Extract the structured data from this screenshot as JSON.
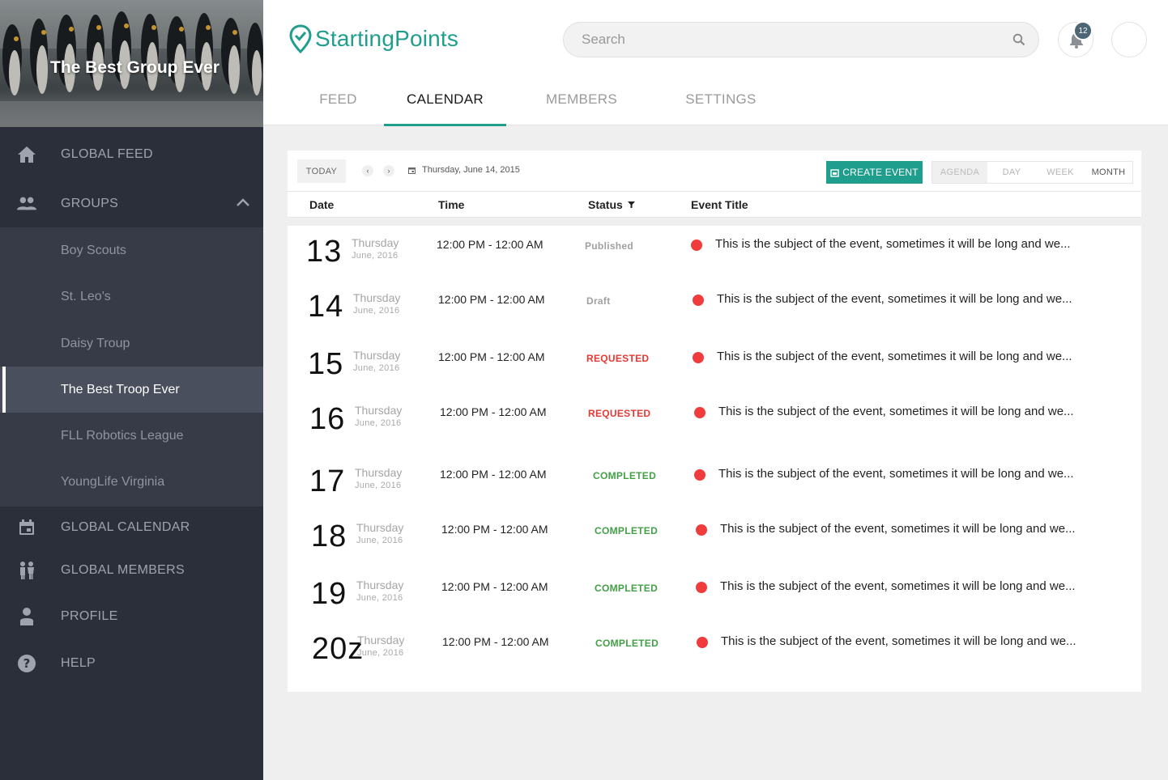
{
  "group": {
    "title": "The Best Group Ever"
  },
  "nav": {
    "global_feed": "GLOBAL FEED",
    "groups": "GROUPS",
    "global_calendar": "GLOBAL CALENDAR",
    "global_members": "GLOBAL MEMBERS",
    "profile": "PROFILE",
    "help": "HELP"
  },
  "groups": [
    {
      "label": "Boy Scouts"
    },
    {
      "label": "St. Leo's"
    },
    {
      "label": "Daisy Troup"
    },
    {
      "label": "The Best Troop Ever",
      "active": true
    },
    {
      "label": "FLL Robotics League"
    },
    {
      "label": "YoungLife Virginia"
    }
  ],
  "header": {
    "logo": "StartingPoints",
    "search_placeholder": "Search",
    "notification_count": "12",
    "tabs": [
      {
        "label": "FEED"
      },
      {
        "label": "CALENDAR",
        "active": true
      },
      {
        "label": "MEMBERS"
      },
      {
        "label": "SETTINGS"
      }
    ]
  },
  "toolbar": {
    "today": "TODAY",
    "prev": "‹",
    "next": "›",
    "current_date": "Thursday, June 14, 2015",
    "create_event": "CREATE EVENT",
    "views": {
      "agenda": "AGENDA",
      "day": "DAY",
      "week": "WEEK",
      "month": "MONTH"
    }
  },
  "table": {
    "columns": {
      "date": "Date",
      "time": "Time",
      "status": "Status",
      "title": "Event Title"
    },
    "rows": [
      {
        "day": "13",
        "dow": "Thursday",
        "month": "June, 2016",
        "time": "12:00 PM - 12:00 AM",
        "status": "Published",
        "title": "This is the subject of the event, sometimes it will be long and we..."
      },
      {
        "day": "14",
        "dow": "Thursday",
        "month": "June, 2016",
        "time": "12:00 PM - 12:00 AM",
        "status": "Draft",
        "title": "This is the subject of the event, sometimes it will be long and we..."
      },
      {
        "day": "15",
        "dow": "Thursday",
        "month": "June, 2016",
        "time": "12:00 PM - 12:00 AM",
        "status": "REQUESTED",
        "title": "This is the subject of the event, sometimes it will be long and we..."
      },
      {
        "day": "16",
        "dow": "Thursday",
        "month": "June, 2016",
        "time": "12:00 PM - 12:00 AM",
        "status": "REQUESTED",
        "title": "This is the subject of the event, sometimes it will be long and we..."
      },
      {
        "day": "17",
        "dow": "Thursday",
        "month": "June, 2016",
        "time": "12:00 PM - 12:00 AM",
        "status": "COMPLETED",
        "title": "This is the subject of the event, sometimes it will be long and we..."
      },
      {
        "day": "18",
        "dow": "Thursday",
        "month": "June, 2016",
        "time": "12:00 PM - 12:00 AM",
        "status": "COMPLETED",
        "title": "This is the subject of the event, sometimes it will be long and we..."
      },
      {
        "day": "19",
        "dow": "Thursday",
        "month": "June, 2016",
        "time": "12:00 PM - 12:00 AM",
        "status": "COMPLETED",
        "title": "This is the subject of the event, sometimes it will be long and we..."
      },
      {
        "day": "20z",
        "dow": "Thursday",
        "month": "June, 2016",
        "time": "12:00 PM - 12:00 AM",
        "status": "COMPLETED",
        "title": "This is the subject of the event, sometimes it will be long and we..."
      }
    ]
  },
  "colors": {
    "accent": "#1f9e8e",
    "sidebar": "#2b2f3a",
    "published": "#a0a0a0",
    "draft": "#a0a0a0",
    "requested": "#e53935",
    "completed": "#43a047",
    "event_dot": "#f03c3c"
  },
  "icons": {
    "global_feed": "home-icon",
    "groups": "people-icon",
    "global_calendar": "calendar-icon",
    "global_members": "family-icon",
    "profile": "person-icon",
    "help": "help-icon"
  }
}
